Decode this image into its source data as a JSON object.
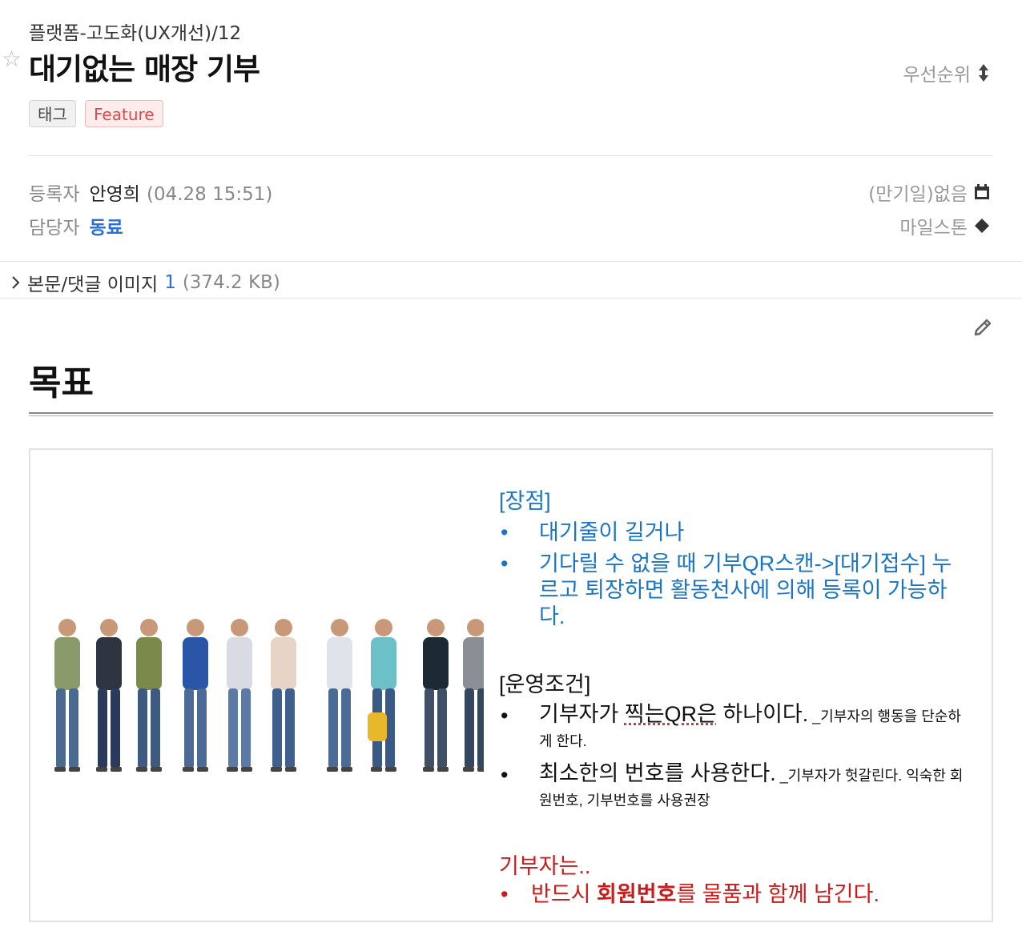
{
  "breadcrumb": "플랫폼-고도화(UX개선)/12",
  "title": "대기없는 매장 기부",
  "priority_label": "우선순위",
  "tags": [
    "태그",
    "Feature"
  ],
  "meta": {
    "registrant_label": "등록자",
    "registrant_name": "안영희",
    "registered_time": "(04.28 15:51)",
    "assignee_label": "담당자",
    "assignee_name": "동료",
    "due_label": "(만기일)없음",
    "milestone_label": "마일스톤"
  },
  "attachments": {
    "label": "본문/댓글 이미지",
    "count": "1",
    "size": "(374.2 KB)"
  },
  "body": {
    "heading": "목표"
  },
  "slide": {
    "advantages_title": "[장점]",
    "advantages": [
      "대기줄이 길거나",
      "기다릴 수 없을 때 기부QR스캔->[대기접수] 누르고 퇴장하면 활동천사에 의해 등록이 가능하다."
    ],
    "conditions_title": "[운영조건]",
    "condition1_main_a": "기부자가 ",
    "condition1_main_b": "찍는QR은",
    "condition1_main_c": " 하나이다.",
    "condition1_note": " _기부자의 행동을 단순하게 한다.",
    "condition2_main": "최소한의 번호를 사용한다.",
    "condition2_note": " _기부자가 헛갈린다. 익숙한 회원번호, 기부번호를 사용권장",
    "donor_title": "기부자는..",
    "donor_a": "반드시 ",
    "donor_b": "회원번호",
    "donor_c": "를 물품과 함께 남긴다."
  },
  "colors": {
    "link_blue": "#2a6fd6",
    "slide_blue": "#1a75c4",
    "slide_red": "#cc1a1a",
    "feature_tag": "#e0494a"
  },
  "icons": [
    "star-outline-icon",
    "sort-arrows-icon",
    "calendar-icon",
    "diamond-icon",
    "chevron-right-icon",
    "pencil-icon"
  ]
}
